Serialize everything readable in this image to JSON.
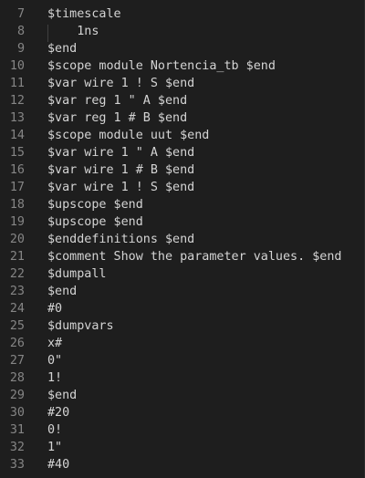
{
  "editor": {
    "lines": [
      {
        "num": "7",
        "text": "$timescale"
      },
      {
        "num": "8",
        "text": "    1ns"
      },
      {
        "num": "9",
        "text": "$end"
      },
      {
        "num": "10",
        "text": "$scope module Nortencia_tb $end"
      },
      {
        "num": "11",
        "text": "$var wire 1 ! S $end"
      },
      {
        "num": "12",
        "text": "$var reg 1 \" A $end"
      },
      {
        "num": "13",
        "text": "$var reg 1 # B $end"
      },
      {
        "num": "14",
        "text": "$scope module uut $end"
      },
      {
        "num": "15",
        "text": "$var wire 1 \" A $end"
      },
      {
        "num": "16",
        "text": "$var wire 1 # B $end"
      },
      {
        "num": "17",
        "text": "$var wire 1 ! S $end"
      },
      {
        "num": "18",
        "text": "$upscope $end"
      },
      {
        "num": "19",
        "text": "$upscope $end"
      },
      {
        "num": "20",
        "text": "$enddefinitions $end"
      },
      {
        "num": "21",
        "text": "$comment Show the parameter values. $end"
      },
      {
        "num": "22",
        "text": "$dumpall"
      },
      {
        "num": "23",
        "text": "$end"
      },
      {
        "num": "24",
        "text": "#0"
      },
      {
        "num": "25",
        "text": "$dumpvars"
      },
      {
        "num": "26",
        "text": "x#"
      },
      {
        "num": "27",
        "text": "0\""
      },
      {
        "num": "28",
        "text": "1!"
      },
      {
        "num": "29",
        "text": "$end"
      },
      {
        "num": "30",
        "text": "#20"
      },
      {
        "num": "31",
        "text": "0!"
      },
      {
        "num": "32",
        "text": "1\""
      },
      {
        "num": "33",
        "text": "#40"
      }
    ]
  }
}
